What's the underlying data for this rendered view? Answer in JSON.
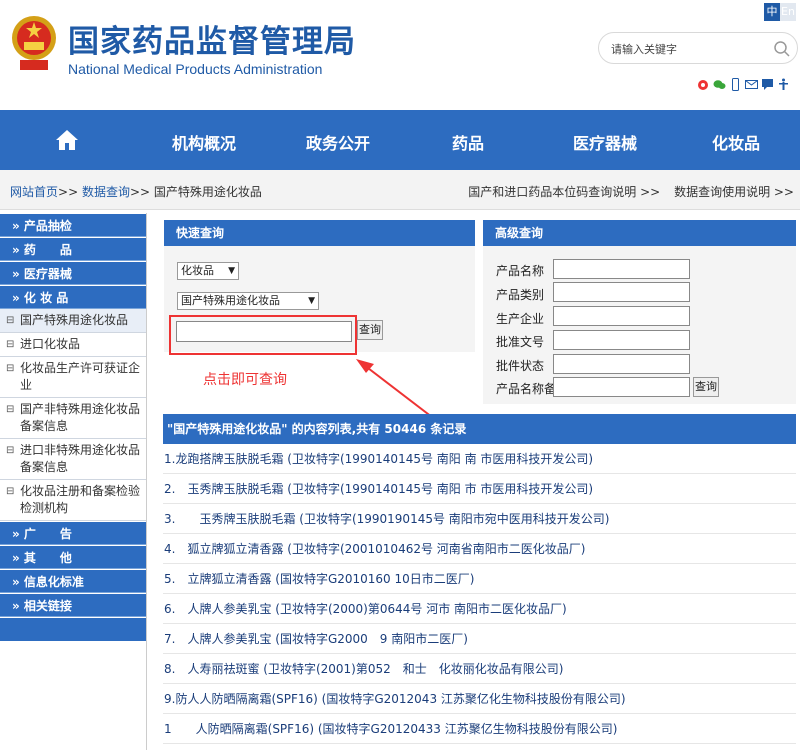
{
  "header": {
    "title_cn": "国家药品监督管理局",
    "title_en": "National Medical Products Administration",
    "lang_zh": "中",
    "lang_en": "En",
    "search_placeholder": "请输入关键字",
    "social_icons": [
      "weibo-icon",
      "wechat-icon",
      "mobile-icon",
      "mail-icon",
      "message-icon",
      "accessibility-icon"
    ]
  },
  "nav": {
    "items": [
      "机构概况",
      "政务公开",
      "药品",
      "医疗器械",
      "化妆品"
    ]
  },
  "breadcrumb": {
    "home": "网站首页",
    "sep": ">>",
    "data": "数据查询",
    "current": "国产特殊用途化妆品",
    "right1": "国产和进口药品本位码查询说明 >>",
    "right2": "数据查询使用说明 >>"
  },
  "sidebar": {
    "heads": [
      "» 产品抽检",
      "» 药　　品",
      "» 医疗器械",
      "» 化 妆 品"
    ],
    "subs": [
      "国产特殊用途化妆品",
      "进口化妆品",
      "化妆品生产许可获证企业",
      "国产非特殊用途化妆品备案信息",
      "进口非特殊用途化妆品备案信息",
      "化妆品注册和备案检验检测机构"
    ],
    "heads2": [
      "» 广　　告",
      "» 其　　他",
      "» 信息化标准",
      "» 相关链接"
    ]
  },
  "quick": {
    "title": "快速查询",
    "select1": "化妆品",
    "select2": "国产特殊用途化妆品",
    "button": "查询",
    "hint": "点击即可查询"
  },
  "advanced": {
    "title": "高级查询",
    "labels": [
      "产品名称",
      "产品类别",
      "生产企业",
      "批准文号",
      "批件状态",
      "产品名称备注"
    ],
    "button": "查询"
  },
  "results": {
    "header": "\"国产特殊用途化妆品\" 的内容列表,共有 50446 条记录",
    "rows": [
      "1.龙跑搭牌玉肤脱毛霜 (卫妆特字(1990140145号 南阳 南 市医用科技开发公司)",
      "2.　玉秀牌玉肤脱毛霜 (卫妆特字(1990140145号 南阳 市 市医用科技开发公司)",
      "3.　　玉秀牌玉肤脱毛霜 (卫妆特字(1990190145号 南阳市宛中医用科技开发公司)",
      "4.　狐立牌狐立清香露 (卫妆特字(2001010462号 河南省南阳市二医化妆品厂)",
      "5.　立牌狐立清香露 (国妆特字G2010160 10日市二医厂)",
      "6.　人牌人参美乳宝 (卫妆特字(2000)第0644号 河市 南阳市二医化妆品厂)",
      "7.　人牌人参美乳宝 (国妆特字G2000　9 南阳市二医厂)",
      "8.　人寿丽祛斑蜜 (卫妆特字(2001)第052　和士　化妆丽化妆品有限公司)",
      "9.防人人防晒隔离霜(SPF16) (国妆特字G2012043 江苏聚亿化生物科技股份有限公司)",
      "1　　人防晒隔离霜(SPF16) (国妆特字G20120433 江苏聚亿生物科技股份有限公司)"
    ]
  },
  "colors": {
    "brand_blue": "#2d6cc0",
    "logo_blue": "#1f5aa6",
    "highlight_red": "#e33"
  }
}
